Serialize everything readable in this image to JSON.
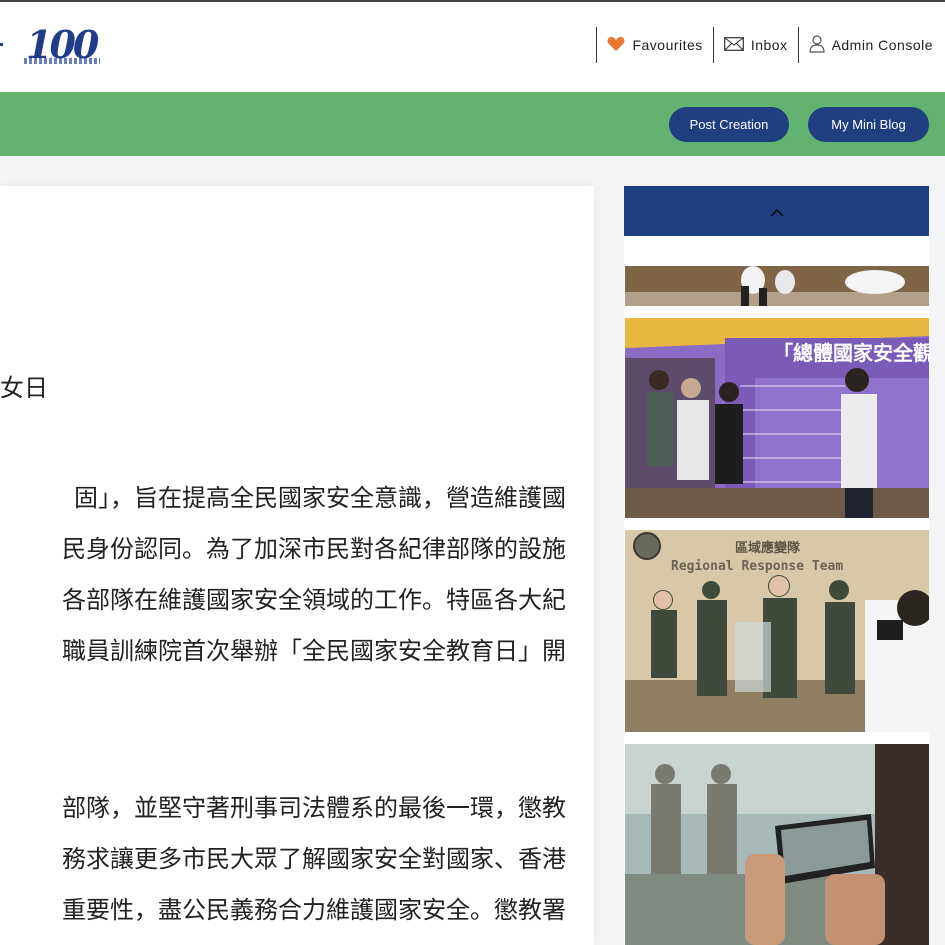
{
  "header": {
    "logo_text": "100",
    "nav": [
      {
        "label": "Favourites",
        "icon": "heart-icon"
      },
      {
        "label": "Inbox",
        "icon": "envelope-icon"
      },
      {
        "label": "Admin Console",
        "icon": "user-icon"
      }
    ]
  },
  "toolbar": {
    "post_creation": "Post Creation",
    "my_mini_blog": "My Mini Blog"
  },
  "article": {
    "title_fragment": "女日",
    "paragraph1": [
      "固」，旨在提高全民國家安全意識，營造維護國",
      "民身份認同。為了加深市民對各紀律部隊的設施",
      "各部隊在維護國家安全領域的工作。特區各大紀",
      "職員訓練院首次舉辦「全民國家安全教育日」開"
    ],
    "paragraph2": [
      "部隊，並堅守著刑事司法體系的最後一環，懲教",
      "務求讓更多市民大眾了解國家安全對國家、香港",
      "重要性，盡公民義務合力維護國家安全。懲教署"
    ]
  },
  "sidebar": {
    "scroll_up_icon": "chevron-up-icon",
    "photos": [
      {
        "name": "photo-crowd"
      },
      {
        "name": "photo-exhibition-board",
        "board_title": "「總體國家安全觀」"
      },
      {
        "name": "photo-regional-response-team",
        "sign_text": "區域應變隊",
        "sign_text_en": "Regional Response Team"
      },
      {
        "name": "photo-phone-capture"
      }
    ]
  },
  "colors": {
    "brand_navy": "#1f3f80",
    "accent_green": "#62b36f",
    "heart": "#e8752e"
  }
}
